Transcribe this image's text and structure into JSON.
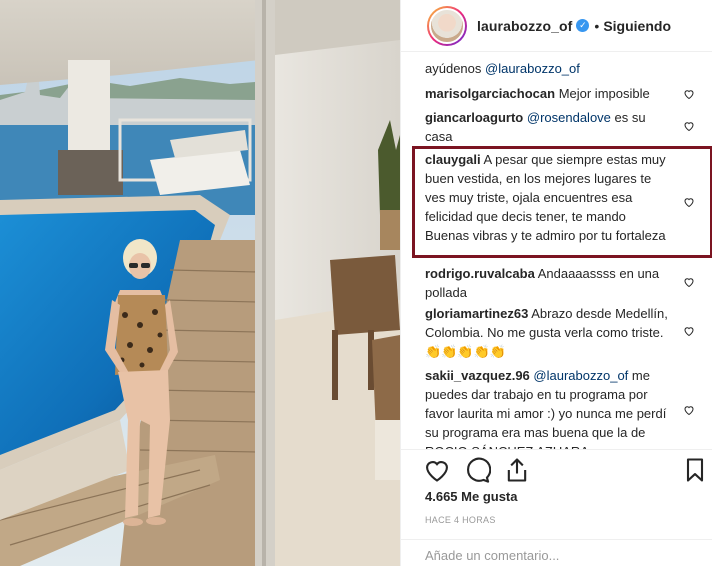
{
  "post": {
    "photo_icon": "photo",
    "header": {
      "username": "laurabozzo_of",
      "verified_icon": "verified-badge-icon",
      "separator": "•",
      "follow_status": "Siguiendo"
    },
    "comments": [
      {
        "user": "",
        "text": "ayúdenos ",
        "mention": "@laurabozzo_of",
        "after": ""
      },
      {
        "user": "marisolgarciachocan",
        "text": "Mejor imposible",
        "mention": "",
        "after": ""
      },
      {
        "user": "giancarloagurto",
        "text": "",
        "mention": "@rosendalove",
        "after": " es su casa"
      },
      {
        "user": "clauygali",
        "text": "A pesar que siempre estas muy buen vestida, en los mejores lugares te ves muy triste, ojala encuentres esa felicidad que decis tener, te mando Buenas vibras y te admiro por tu fortaleza",
        "mention": "",
        "after": ""
      },
      {
        "user": "rodrigo.ruvalcaba",
        "text": "Andaaaassss en una pollada",
        "mention": "",
        "after": ""
      },
      {
        "user": "gloriamartinez63",
        "text": "Abrazo desde Medellín, Colombia. No me gusta verla como triste. 👏👏👏👏👏",
        "mention": "",
        "after": ""
      },
      {
        "user": "sakii_vazquez.96",
        "text": "",
        "mention": "@laurabozzo_of",
        "after": " me puedes dar trabajo en tu programa por favor laurita mi amor :) yo nunca me perdí su programa era mas buena que la de ROCIO SÁNCHEZ AZUARA"
      }
    ],
    "actions": {
      "like_icon": "heart-icon",
      "comment_icon": "comment-icon",
      "share_icon": "share-icon",
      "save_icon": "bookmark-icon"
    },
    "likes": "4.665 Me gusta",
    "timestamp": "HACE 4 HORAS",
    "comment_input": {
      "placeholder": "Añade un comentario..."
    },
    "colors": {
      "highlight_border": "#7b1421",
      "mention": "#003569",
      "verified": "#3897f0",
      "muted": "#999999"
    }
  }
}
